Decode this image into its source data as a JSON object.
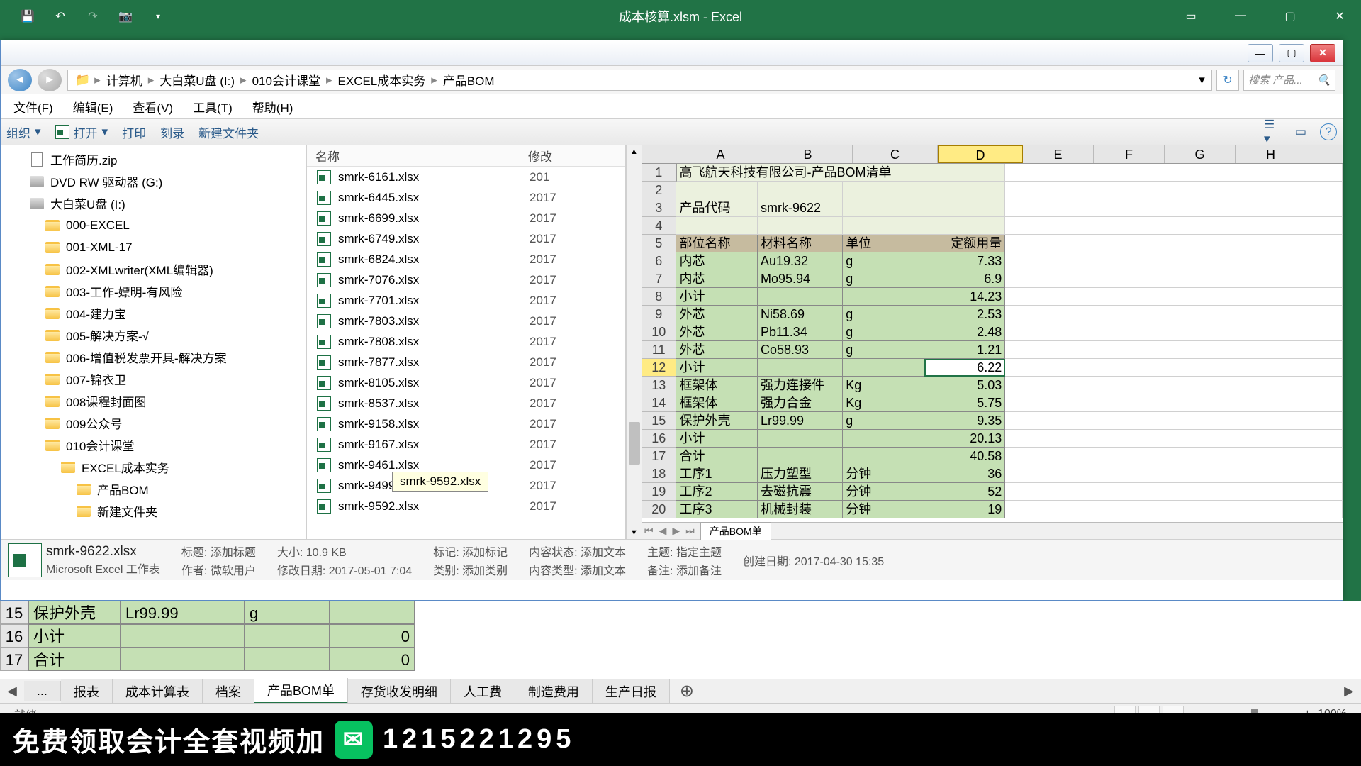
{
  "excel": {
    "title": "成本核算.xlsm - Excel",
    "qat": [
      "save",
      "undo",
      "redo",
      "camera"
    ]
  },
  "explorer": {
    "breadcrumb": [
      "计算机",
      "大白菜U盘 (I:)",
      "010会计课堂",
      "EXCEL成本实务",
      "产品BOM"
    ],
    "search_placeholder": "搜索 产品...",
    "menu": {
      "file": "文件(F)",
      "edit": "编辑(E)",
      "view": "查看(V)",
      "tools": "工具(T)",
      "help": "帮助(H)"
    },
    "toolbar": {
      "organize": "组织",
      "open": "打开",
      "print": "打印",
      "burn": "刻录",
      "newfolder": "新建文件夹"
    },
    "tree": [
      {
        "label": "工作简历.zip",
        "icon": "zip",
        "indent": 0
      },
      {
        "label": "DVD RW 驱动器 (G:)",
        "icon": "drive",
        "indent": 0
      },
      {
        "label": "大白菜U盘 (I:)",
        "icon": "drive",
        "indent": 0
      },
      {
        "label": "000-EXCEL",
        "icon": "folder",
        "indent": 1
      },
      {
        "label": "001-XML-17",
        "icon": "folder",
        "indent": 1
      },
      {
        "label": "002-XMLwriter(XML编辑器)",
        "icon": "folder",
        "indent": 1
      },
      {
        "label": "003-工作-嫖明-有风险",
        "icon": "folder",
        "indent": 1
      },
      {
        "label": "004-建力宝",
        "icon": "folder",
        "indent": 1
      },
      {
        "label": "005-解决方案-√",
        "icon": "folder",
        "indent": 1
      },
      {
        "label": "006-增值税发票开具-解决方案",
        "icon": "folder",
        "indent": 1
      },
      {
        "label": "007-锦衣卫",
        "icon": "folder",
        "indent": 1
      },
      {
        "label": "008课程封面图",
        "icon": "folder",
        "indent": 1
      },
      {
        "label": "009公众号",
        "icon": "folder",
        "indent": 1
      },
      {
        "label": "010会计课堂",
        "icon": "folder",
        "indent": 1
      },
      {
        "label": "EXCEL成本实务",
        "icon": "folder",
        "indent": 2
      },
      {
        "label": "产品BOM",
        "icon": "folder",
        "indent": 3
      },
      {
        "label": "新建文件夹",
        "icon": "folder",
        "indent": 3
      }
    ],
    "filelist": {
      "col_name": "名称",
      "col_date": "修改",
      "rows": [
        {
          "name": "smrk-6161.xlsx",
          "date": "201"
        },
        {
          "name": "smrk-6445.xlsx",
          "date": "2017"
        },
        {
          "name": "smrk-6699.xlsx",
          "date": "2017"
        },
        {
          "name": "smrk-6749.xlsx",
          "date": "2017"
        },
        {
          "name": "smrk-6824.xlsx",
          "date": "2017"
        },
        {
          "name": "smrk-7076.xlsx",
          "date": "2017"
        },
        {
          "name": "smrk-7701.xlsx",
          "date": "2017"
        },
        {
          "name": "smrk-7803.xlsx",
          "date": "2017"
        },
        {
          "name": "smrk-7808.xlsx",
          "date": "2017"
        },
        {
          "name": "smrk-7877.xlsx",
          "date": "2017"
        },
        {
          "name": "smrk-8105.xlsx",
          "date": "2017"
        },
        {
          "name": "smrk-8537.xlsx",
          "date": "2017"
        },
        {
          "name": "smrk-9158.xlsx",
          "date": "2017"
        },
        {
          "name": "smrk-9167.xlsx",
          "date": "2017"
        },
        {
          "name": "smrk-9461.xlsx",
          "date": "2017"
        },
        {
          "name": "smrk-9499.x",
          "date": "2017"
        },
        {
          "name": "smrk-9592.xlsx",
          "date": "2017"
        }
      ],
      "tooltip": "smrk-9592.xlsx"
    },
    "details": {
      "filename": "smrk-9622.xlsx",
      "filetype": "Microsoft Excel 工作表",
      "title_lbl": "标题:",
      "title_val": "添加标题",
      "author_lbl": "作者:",
      "author_val": "微软用户",
      "size_lbl": "大小:",
      "size_val": "10.9 KB",
      "mdate_lbl": "修改日期:",
      "mdate_val": "2017-05-01 7:04",
      "tag_lbl": "标记:",
      "tag_val": "添加标记",
      "cat_lbl": "类别:",
      "cat_val": "添加类别",
      "cstat_lbl": "内容状态:",
      "cstat_val": "添加文本",
      "ctype_lbl": "内容类型:",
      "ctype_val": "添加文本",
      "subj_lbl": "主题:",
      "subj_val": "指定主题",
      "note_lbl": "备注:",
      "note_val": "添加备注",
      "cdate_lbl": "创建日期:",
      "cdate_val": "2017-04-30 15:35"
    }
  },
  "preview": {
    "cols": [
      "A",
      "B",
      "C",
      "D",
      "E",
      "F",
      "G",
      "H"
    ],
    "title": "高飞航天科技有限公司-产品BOM清单",
    "prodcode_lbl": "产品代码",
    "prodcode_val": "smrk-9622",
    "headers": {
      "a": "部位名称",
      "b": "材料名称",
      "c": "单位",
      "d": "定额用量"
    },
    "rows": [
      {
        "r": 6,
        "a": "内芯",
        "b": "Au19.32",
        "c": "g",
        "d": "7.33"
      },
      {
        "r": 7,
        "a": "内芯",
        "b": "Mo95.94",
        "c": "g",
        "d": "6.9"
      },
      {
        "r": 8,
        "a": "小计",
        "b": "",
        "c": "",
        "d": "14.23"
      },
      {
        "r": 9,
        "a": "外芯",
        "b": "Ni58.69",
        "c": "g",
        "d": "2.53"
      },
      {
        "r": 10,
        "a": "外芯",
        "b": "Pb11.34",
        "c": "g",
        "d": "2.48"
      },
      {
        "r": 11,
        "a": "外芯",
        "b": "Co58.93",
        "c": "g",
        "d": "1.21"
      },
      {
        "r": 12,
        "a": "小计",
        "b": "",
        "c": "",
        "d": "6.22",
        "sel": true
      },
      {
        "r": 13,
        "a": "框架体",
        "b": "强力连接件",
        "c": "Kg",
        "d": "5.03"
      },
      {
        "r": 14,
        "a": "框架体",
        "b": "强力合金",
        "c": "Kg",
        "d": "5.75"
      },
      {
        "r": 15,
        "a": "保护外壳",
        "b": "Lr99.99",
        "c": "g",
        "d": "9.35"
      },
      {
        "r": 16,
        "a": "小计",
        "b": "",
        "c": "",
        "d": "20.13"
      },
      {
        "r": 17,
        "a": "合计",
        "b": "",
        "c": "",
        "d": "40.58"
      },
      {
        "r": 18,
        "a": "工序1",
        "b": "压力塑型",
        "c": "分钟",
        "d": "36"
      },
      {
        "r": 19,
        "a": "工序2",
        "b": "去磁抗震",
        "c": "分钟",
        "d": "52"
      },
      {
        "r": 20,
        "a": "工序3",
        "b": "机械封装",
        "c": "分钟",
        "d": "19"
      }
    ],
    "tab": "产品BOM单"
  },
  "under": {
    "row15": {
      "n": "15",
      "a": "保护外壳",
      "b": "Lr99.99",
      "c": "g",
      "d": ""
    },
    "row16": {
      "n": "16",
      "a": "小计",
      "b": "",
      "c": "",
      "d": "0"
    },
    "row17": {
      "n": "17",
      "a": "合计",
      "b": "",
      "c": "",
      "d": "0"
    }
  },
  "tabs": {
    "dots": "...",
    "t1": "报表",
    "t2": "成本计算表",
    "t3": "档案",
    "t4": "产品BOM单",
    "t5": "存货收发明细",
    "t6": "人工费",
    "t7": "制造费用",
    "t8": "生产日报"
  },
  "status": {
    "ready": "就绪",
    "zoom": "100%"
  },
  "banner": {
    "text": "免费领取会计全套视频加",
    "num": "1215221295"
  }
}
